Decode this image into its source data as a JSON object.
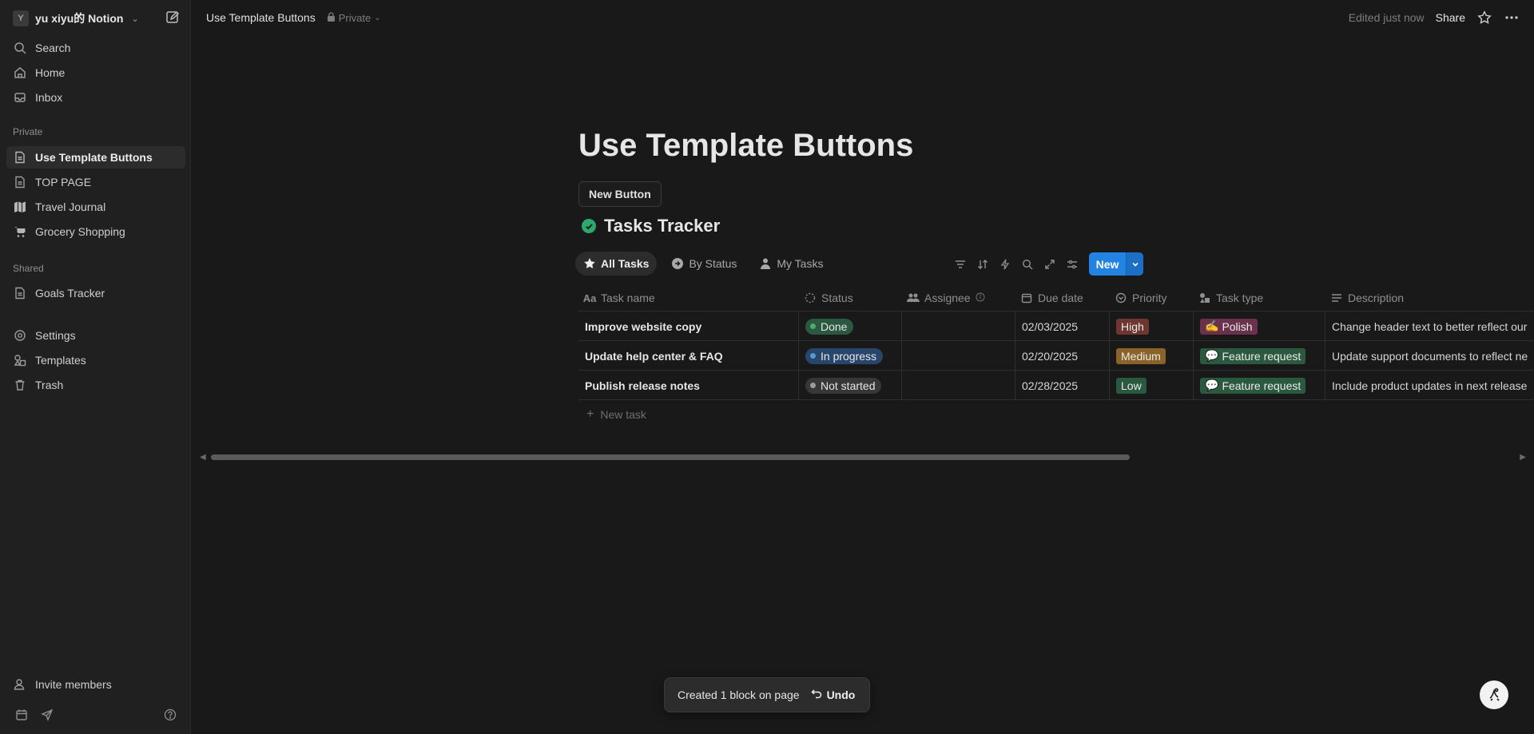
{
  "workspace": {
    "avatar": "Y",
    "name": "yu xiyu的 Notion"
  },
  "sidebar": {
    "top_items": [
      {
        "label": "Search",
        "icon": "search-icon"
      },
      {
        "label": "Home",
        "icon": "home-icon"
      },
      {
        "label": "Inbox",
        "icon": "inbox-icon"
      }
    ],
    "private_label": "Private",
    "private_items": [
      {
        "label": "Use Template Buttons",
        "icon": "page-icon",
        "active": true
      },
      {
        "label": "TOP PAGE",
        "icon": "page-icon"
      },
      {
        "label": "Travel Journal",
        "icon": "map-icon"
      },
      {
        "label": "Grocery Shopping",
        "icon": "cart-icon"
      }
    ],
    "shared_label": "Shared",
    "shared_items": [
      {
        "label": "Goals Tracker",
        "icon": "page-icon"
      }
    ],
    "util_items": [
      {
        "label": "Settings",
        "icon": "gear-icon"
      },
      {
        "label": "Templates",
        "icon": "templates-icon"
      },
      {
        "label": "Trash",
        "icon": "trash-icon"
      }
    ],
    "invite_label": "Invite members"
  },
  "topbar": {
    "breadcrumb_title": "Use Template Buttons",
    "privacy": "Private",
    "edited": "Edited just now",
    "share": "Share"
  },
  "page": {
    "title": "Use Template Buttons",
    "new_button_label": "New Button",
    "database_title": "Tasks Tracker",
    "views": [
      {
        "label": "All Tasks",
        "icon": "star-icon",
        "active": true
      },
      {
        "label": "By Status",
        "icon": "arrow-circle-icon"
      },
      {
        "label": "My Tasks",
        "icon": "person-icon"
      }
    ],
    "new_label": "New",
    "columns": [
      {
        "label": "Task name",
        "icon": "text-icon"
      },
      {
        "label": "Status",
        "icon": "status-icon"
      },
      {
        "label": "Assignee",
        "icon": "people-icon"
      },
      {
        "label": "Due date",
        "icon": "calendar-icon"
      },
      {
        "label": "Priority",
        "icon": "priority-icon"
      },
      {
        "label": "Task type",
        "icon": "shapes-icon"
      },
      {
        "label": "Description",
        "icon": "lines-icon"
      }
    ],
    "rows": [
      {
        "name": "Improve website copy",
        "status": "Done",
        "status_color": "#2b593f",
        "status_dot": "#4dab6f",
        "assignee": "",
        "due": "02/03/2025",
        "priority": "High",
        "priority_color": "#6e3630",
        "type_emoji": "✍️",
        "type": "Polish",
        "type_color": "#69314c",
        "description": "Change header text to better reflect our"
      },
      {
        "name": "Update help center & FAQ",
        "status": "In progress",
        "status_color": "#28456c",
        "status_dot": "#529cca",
        "assignee": "",
        "due": "02/20/2025",
        "priority": "Medium",
        "priority_color": "#89632a",
        "type_emoji": "💬",
        "type": "Feature request",
        "type_color": "#2b593f",
        "description": "Update support documents to reflect ne"
      },
      {
        "name": "Publish release notes",
        "status": "Not started",
        "status_color": "#373737",
        "status_dot": "#9b9b9b",
        "assignee": "",
        "due": "02/28/2025",
        "priority": "Low",
        "priority_color": "#2b593f",
        "type_emoji": "💬",
        "type": "Feature request",
        "type_color": "#2b593f",
        "description": "Include product updates in next release"
      }
    ],
    "new_task_label": "New task"
  },
  "toast": {
    "message": "Created 1 block on page",
    "undo": "Undo"
  }
}
